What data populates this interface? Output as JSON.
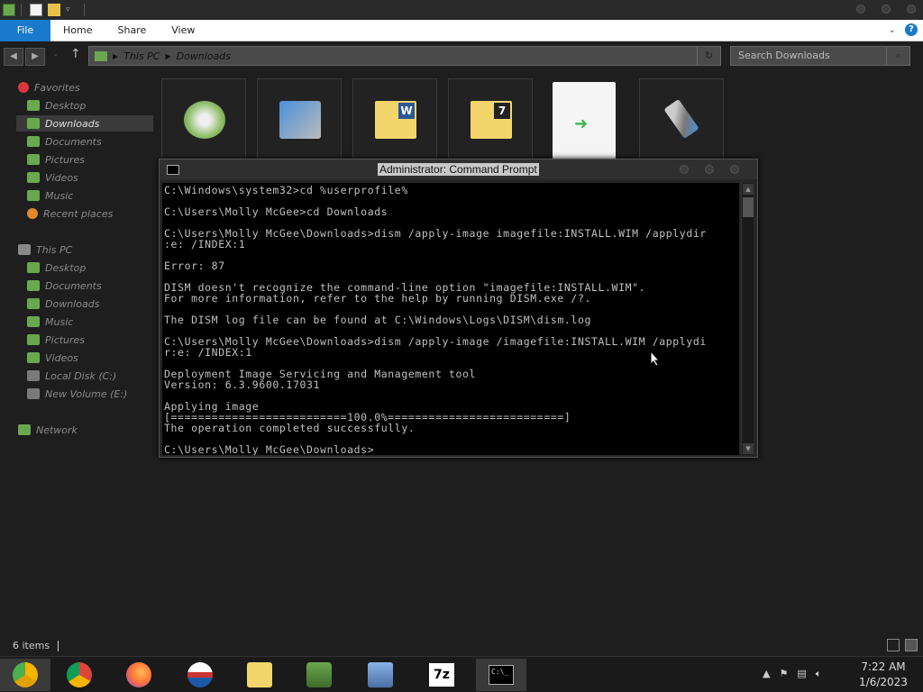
{
  "ribbon": {
    "tabs": [
      "File",
      "Home",
      "Share",
      "View"
    ]
  },
  "address": {
    "crumbs": [
      "This PC",
      "Downloads"
    ],
    "search_placeholder": "Search Downloads"
  },
  "sidebar": {
    "favorites_header": "Favorites",
    "favorites": [
      "Desktop",
      "Downloads",
      "Documents",
      "Pictures",
      "Videos",
      "Music",
      "Recent places"
    ],
    "this_pc_header": "This PC",
    "this_pc": [
      "Desktop",
      "Documents",
      "Downloads",
      "Music",
      "Pictures",
      "Videos",
      "Local Disk (C:)",
      "New Volume (E:)"
    ],
    "network_header": "Network"
  },
  "files": {
    "icons": [
      "disc-setup-icon",
      "installer-icon",
      "word-folder-icon",
      "7zip-folder-icon",
      "shortcut-file-icon",
      "usb-tool-icon"
    ]
  },
  "cmd": {
    "title": "Administrator: Command Prompt",
    "lines": [
      "C:\\Windows\\system32>cd %userprofile%",
      "",
      "C:\\Users\\Molly McGee>cd Downloads",
      "",
      "C:\\Users\\Molly McGee\\Downloads>dism /apply-image imagefile:INSTALL.WIM /applydir",
      ":e: /INDEX:1",
      "",
      "Error: 87",
      "",
      "DISM doesn't recognize the command-line option \"imagefile:INSTALL.WIM\".",
      "For more information, refer to the help by running DISM.exe /?.",
      "",
      "The DISM log file can be found at C:\\Windows\\Logs\\DISM\\dism.log",
      "",
      "C:\\Users\\Molly McGee\\Downloads>dism /apply-image /imagefile:INSTALL.WIM /applydi",
      "r:e: /INDEX:1",
      "",
      "Deployment Image Servicing and Management tool",
      "Version: 6.3.9600.17031",
      "",
      "Applying image",
      "[==========================100.0%==========================]",
      "The operation completed successfully.",
      "",
      "C:\\Users\\Molly McGee\\Downloads>_"
    ]
  },
  "status": {
    "item_count": "6 items"
  },
  "taskbar": {
    "apps": [
      "chrome-canary-icon",
      "chrome-icon",
      "firefox-icon",
      "obama-logo-icon",
      "file-explorer-icon",
      "network-users-icon",
      "remote-desktop-icon",
      "7zip-icon",
      "command-prompt-icon"
    ],
    "time": "7:22 AM",
    "date": "1/6/2023"
  }
}
